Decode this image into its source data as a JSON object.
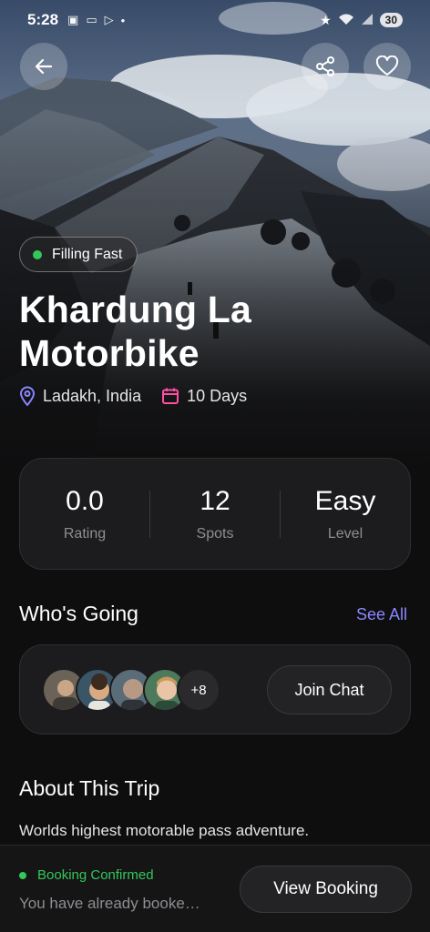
{
  "status_bar": {
    "time": "5:28",
    "battery": "30",
    "left_icons": [
      "camera-scan-icon",
      "sim-icon",
      "play-icon",
      "dot-icon"
    ],
    "right_icons": [
      "star-icon",
      "wifi-icon",
      "signal-icon"
    ]
  },
  "header": {
    "back_icon": "arrow-left-icon",
    "share_icon": "share-icon",
    "favorite_icon": "heart-icon"
  },
  "trip": {
    "badge": "Filling Fast",
    "badge_color": "#34c759",
    "title_line1": "Khardung La",
    "title_line2": "Motorbike",
    "location": "Ladakh, India",
    "duration": "10 Days",
    "location_icon_color": "#8a86ff",
    "calendar_icon_color": "#ff4fa3"
  },
  "stats": [
    {
      "value": "0.0",
      "label": "Rating"
    },
    {
      "value": "12",
      "label": "Spots"
    },
    {
      "value": "Easy",
      "label": "Level"
    }
  ],
  "whos_going": {
    "title": "Who's Going",
    "see_all": "See All",
    "more_count": "+8",
    "join_label": "Join Chat"
  },
  "about": {
    "title": "About This Trip",
    "text": "Worlds highest motorable pass adventure."
  },
  "booking": {
    "status": "Booking Confirmed",
    "message": "You have already booke…",
    "button": "View Booking"
  },
  "colors": {
    "accent": "#8a86ff",
    "success": "#34c759",
    "card_bg": "#1c1c1e"
  }
}
